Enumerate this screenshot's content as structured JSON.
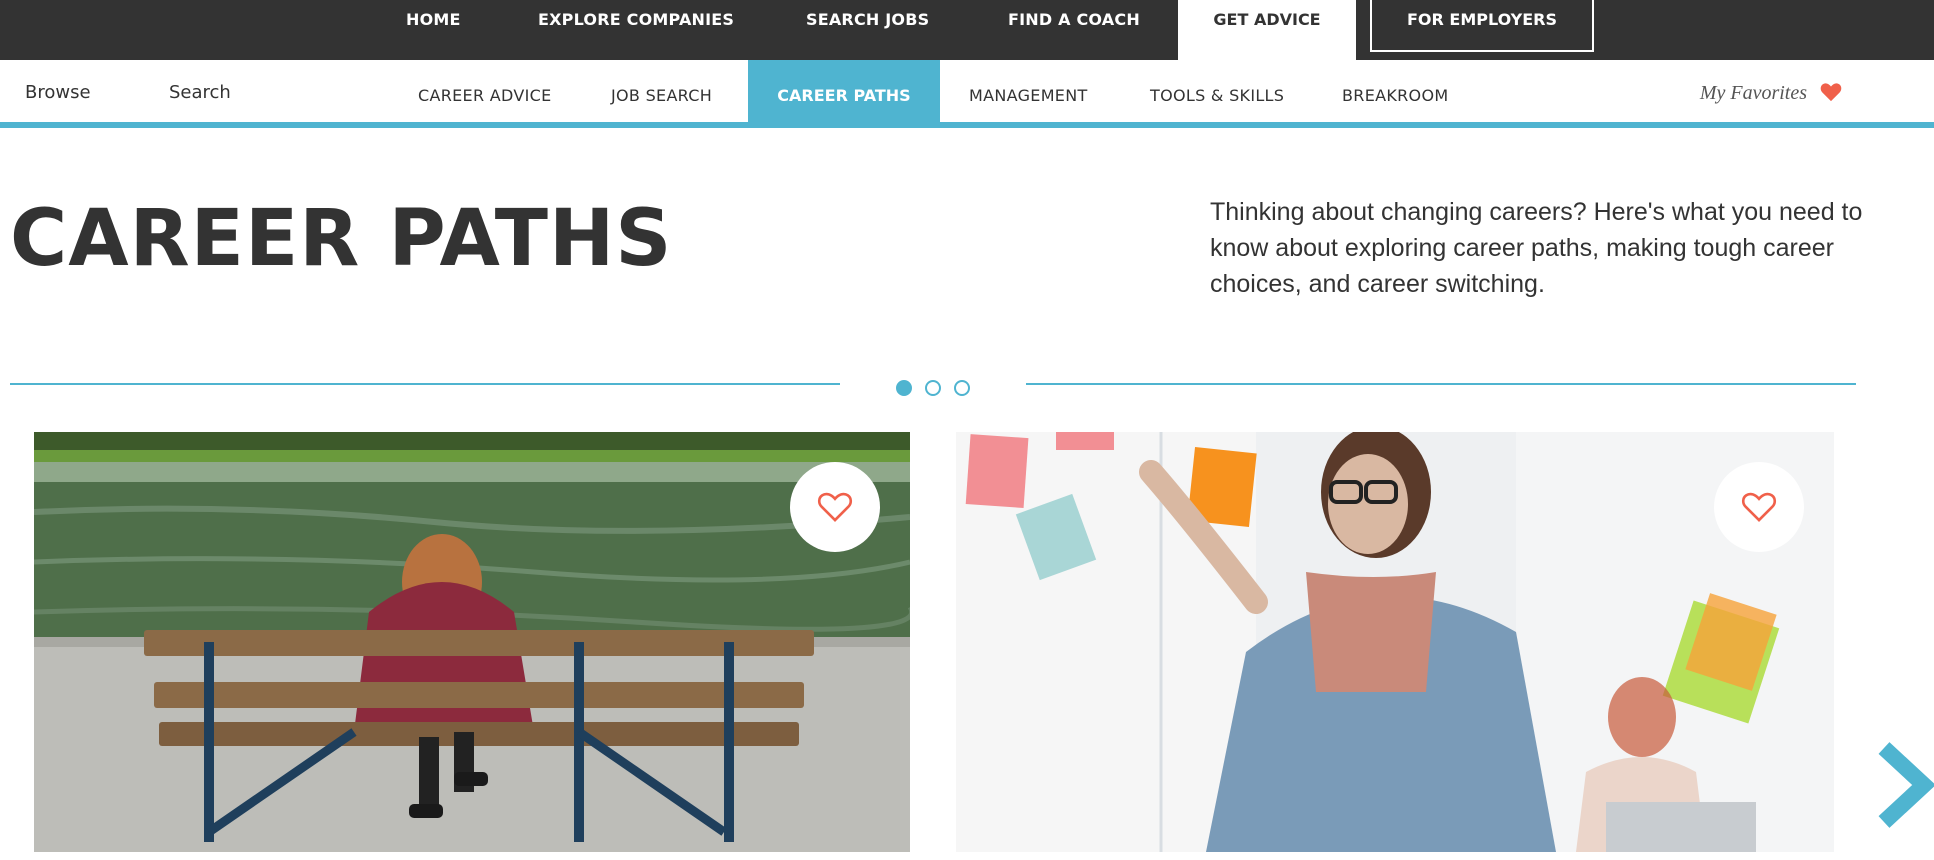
{
  "top_nav": {
    "items": [
      "HOME",
      "EXPLORE COMPANIES",
      "SEARCH JOBS",
      "FIND A COACH"
    ],
    "active": "GET ADVICE",
    "employers": "FOR EMPLOYERS"
  },
  "sub_nav": {
    "browse": "Browse",
    "search": "Search",
    "items": [
      "CAREER ADVICE",
      "JOB SEARCH",
      "CAREER PATHS",
      "MANAGEMENT",
      "TOOLS & SKILLS",
      "BREAKROOM"
    ],
    "active_index": 2,
    "favorites": "My Favorites"
  },
  "hero": {
    "title": "CAREER PATHS",
    "intro": "Thinking about changing careers? Here's what you need to know about exploring career paths, making tough career choices, and career switching."
  },
  "carousel": {
    "dot_count": 3,
    "active_dot": 0
  },
  "cards": [
    {
      "image": "woman-on-park-bench-by-lake",
      "favorite_icon": "heart-outline-icon"
    },
    {
      "image": "woman-arranging-sticky-notes-on-glass",
      "favorite_icon": "heart-outline-icon"
    }
  ],
  "colors": {
    "accent": "#4fb4d0",
    "dark": "#333333",
    "heart": "#f0604a"
  }
}
